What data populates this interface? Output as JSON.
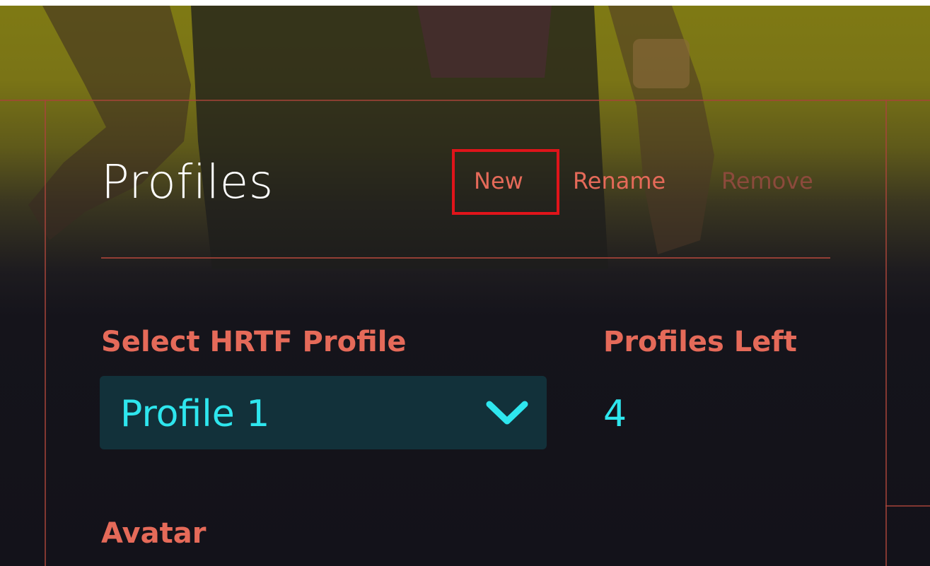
{
  "panel": {
    "title": "Profiles"
  },
  "actions": {
    "new_label": "New",
    "rename_label": "Rename",
    "remove_label": "Remove",
    "highlighted": "New"
  },
  "hrtf": {
    "label": "Select HRTF Profile",
    "selected_value": "Profile 1",
    "dropdown_icon": "chevron-down-icon"
  },
  "profiles_left": {
    "label": "Profiles Left",
    "value": "4"
  },
  "avatar": {
    "label": "Avatar"
  },
  "colors": {
    "accent": "#e56a59",
    "accent_dim": "#8c4a3c",
    "value": "#2ee6ee",
    "dropdown_bg": "#12313a",
    "frame_line": "#a8443a",
    "highlight": "#e0141a",
    "background": "#13121a"
  }
}
